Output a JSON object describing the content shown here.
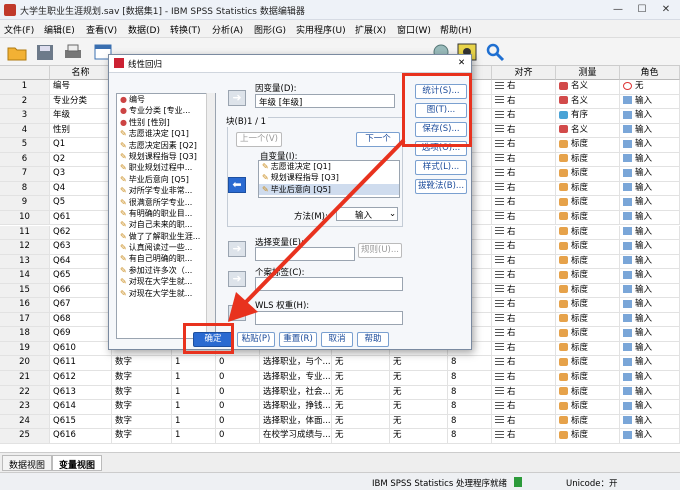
{
  "window": {
    "title": "大学生职业生涯规划.sav [数据集1] - IBM SPSS Statistics 数据编辑器",
    "min": "—",
    "max": "☐",
    "close": "✕"
  },
  "menu": [
    "文件(F)",
    "编辑(E)",
    "查看(V)",
    "数据(D)",
    "转换(T)",
    "分析(A)",
    "图形(G)",
    "实用程序(U)",
    "扩展(X)",
    "窗口(W)",
    "帮助(H)"
  ],
  "grid": {
    "headers": {
      "name": "名称",
      "align": "对齐",
      "measure": "测量",
      "role": "角色"
    },
    "rows": [
      {
        "n": "1",
        "name": "编号",
        "align": "右",
        "measure": "名义",
        "role": "无"
      },
      {
        "n": "2",
        "name": "专业分类",
        "align": "右",
        "measure": "名义",
        "role": "输入"
      },
      {
        "n": "3",
        "name": "年级",
        "align": "右",
        "measure": "有序",
        "role": "输入"
      },
      {
        "n": "4",
        "name": "性别",
        "align": "右",
        "measure": "名义",
        "role": "输入"
      },
      {
        "n": "5",
        "name": "Q1",
        "align": "右",
        "measure": "标度",
        "role": "输入"
      },
      {
        "n": "6",
        "name": "Q2",
        "align": "右",
        "measure": "标度",
        "role": "输入"
      },
      {
        "n": "7",
        "name": "Q3",
        "align": "右",
        "measure": "标度",
        "role": "输入"
      },
      {
        "n": "8",
        "name": "Q4",
        "align": "右",
        "measure": "标度",
        "role": "输入"
      },
      {
        "n": "9",
        "name": "Q5",
        "align": "右",
        "measure": "标度",
        "role": "输入"
      },
      {
        "n": "10",
        "name": "Q61",
        "align": "右",
        "measure": "标度",
        "role": "输入"
      },
      {
        "n": "11",
        "name": "Q62",
        "align": "右",
        "measure": "标度",
        "role": "输入"
      },
      {
        "n": "12",
        "name": "Q63",
        "align": "右",
        "measure": "标度",
        "role": "输入"
      },
      {
        "n": "13",
        "name": "Q64",
        "align": "右",
        "measure": "标度",
        "role": "输入"
      },
      {
        "n": "14",
        "name": "Q65",
        "align": "右",
        "measure": "标度",
        "role": "输入"
      },
      {
        "n": "15",
        "name": "Q66",
        "align": "右",
        "measure": "标度",
        "role": "输入"
      },
      {
        "n": "16",
        "name": "Q67",
        "align": "右",
        "measure": "标度",
        "role": "输入"
      },
      {
        "n": "17",
        "name": "Q68",
        "align": "右",
        "measure": "标度",
        "role": "输入"
      },
      {
        "n": "18",
        "name": "Q69",
        "align": "右",
        "measure": "标度",
        "role": "输入"
      },
      {
        "n": "19",
        "name": "Q610",
        "align": "右",
        "measure": "标度",
        "role": "输入"
      },
      {
        "n": "20",
        "name": "Q611",
        "type": "数字",
        "w": "1",
        "d": "0",
        "label": "选择职业，与个...",
        "val": "无",
        "miss": "无",
        "col": "8",
        "align": "右",
        "measure": "标度",
        "role": "输入"
      },
      {
        "n": "21",
        "name": "Q612",
        "type": "数字",
        "w": "1",
        "d": "0",
        "label": "选择职业，专业...",
        "val": "无",
        "miss": "无",
        "col": "8",
        "align": "右",
        "measure": "标度",
        "role": "输入"
      },
      {
        "n": "22",
        "name": "Q613",
        "type": "数字",
        "w": "1",
        "d": "0",
        "label": "选择职业，社会...",
        "val": "无",
        "miss": "无",
        "col": "8",
        "align": "右",
        "measure": "标度",
        "role": "输入"
      },
      {
        "n": "23",
        "name": "Q614",
        "type": "数字",
        "w": "1",
        "d": "0",
        "label": "选择职业，挣钱...",
        "val": "无",
        "miss": "无",
        "col": "8",
        "align": "右",
        "measure": "标度",
        "role": "输入"
      },
      {
        "n": "24",
        "name": "Q615",
        "type": "数字",
        "w": "1",
        "d": "0",
        "label": "选择职业，体面...",
        "val": "无",
        "miss": "无",
        "col": "8",
        "align": "右",
        "measure": "标度",
        "role": "输入"
      },
      {
        "n": "25",
        "name": "Q616",
        "type": "数字",
        "w": "1",
        "d": "0",
        "label": "在校学习成绩与...",
        "val": "无",
        "miss": "无",
        "col": "8",
        "align": "右",
        "measure": "标度",
        "role": "输入"
      }
    ]
  },
  "dialog": {
    "title": "线性回归",
    "close": "✕",
    "varlist": [
      "编号",
      "专业分类 [专业...",
      "性别 [性别]",
      "志愿谁决定 [Q1]",
      "志愿决定因素 [Q2]",
      "规划课程指导 [Q3]",
      "职业规划过程中...",
      "毕业后意向 [Q5]",
      "对所学专业非常...",
      "很满意所学专业...",
      "有明确的职业目...",
      "对自己未来的职...",
      "做了了解职业生涯...",
      "认真阅读过一些...",
      "有自己明确的职...",
      "参加过许多次（...",
      "对现在大学生就...",
      "对现在大学生就..."
    ],
    "dep_label": "因变量(D):",
    "dep_value": "年级 [年级]",
    "block_label": "块(B)1 / 1",
    "prev": "上一个(V)",
    "next": "下一个",
    "indep_label": "自变量(I):",
    "indep": [
      "志愿谁决定 [Q1]",
      "规划课程指导 [Q3]",
      "毕业后意向 [Q5]"
    ],
    "method_label": "方法(M):",
    "method_value": "输入",
    "sel_label": "选择变量(E):",
    "rule": "规则(U)...",
    "case_label": "个案标签(C):",
    "wls_label": "WLS 权重(H):",
    "side": [
      "统计(S)...",
      "图(T)...",
      "保存(S)...",
      "选项(O)...",
      "样式(L)...",
      "拔靴法(B)..."
    ],
    "bottom": [
      "确定",
      "粘贴(P)",
      "重置(R)",
      "取消",
      "帮助"
    ]
  },
  "tabs": [
    "数据视图",
    "变量视图"
  ],
  "status": {
    "ready": "IBM SPSS Statistics 处理程序就绪",
    "unicode": "Unicode：开"
  },
  "colors": {
    "highlight": "#e8321e",
    "accent": "#1e5ab4"
  }
}
